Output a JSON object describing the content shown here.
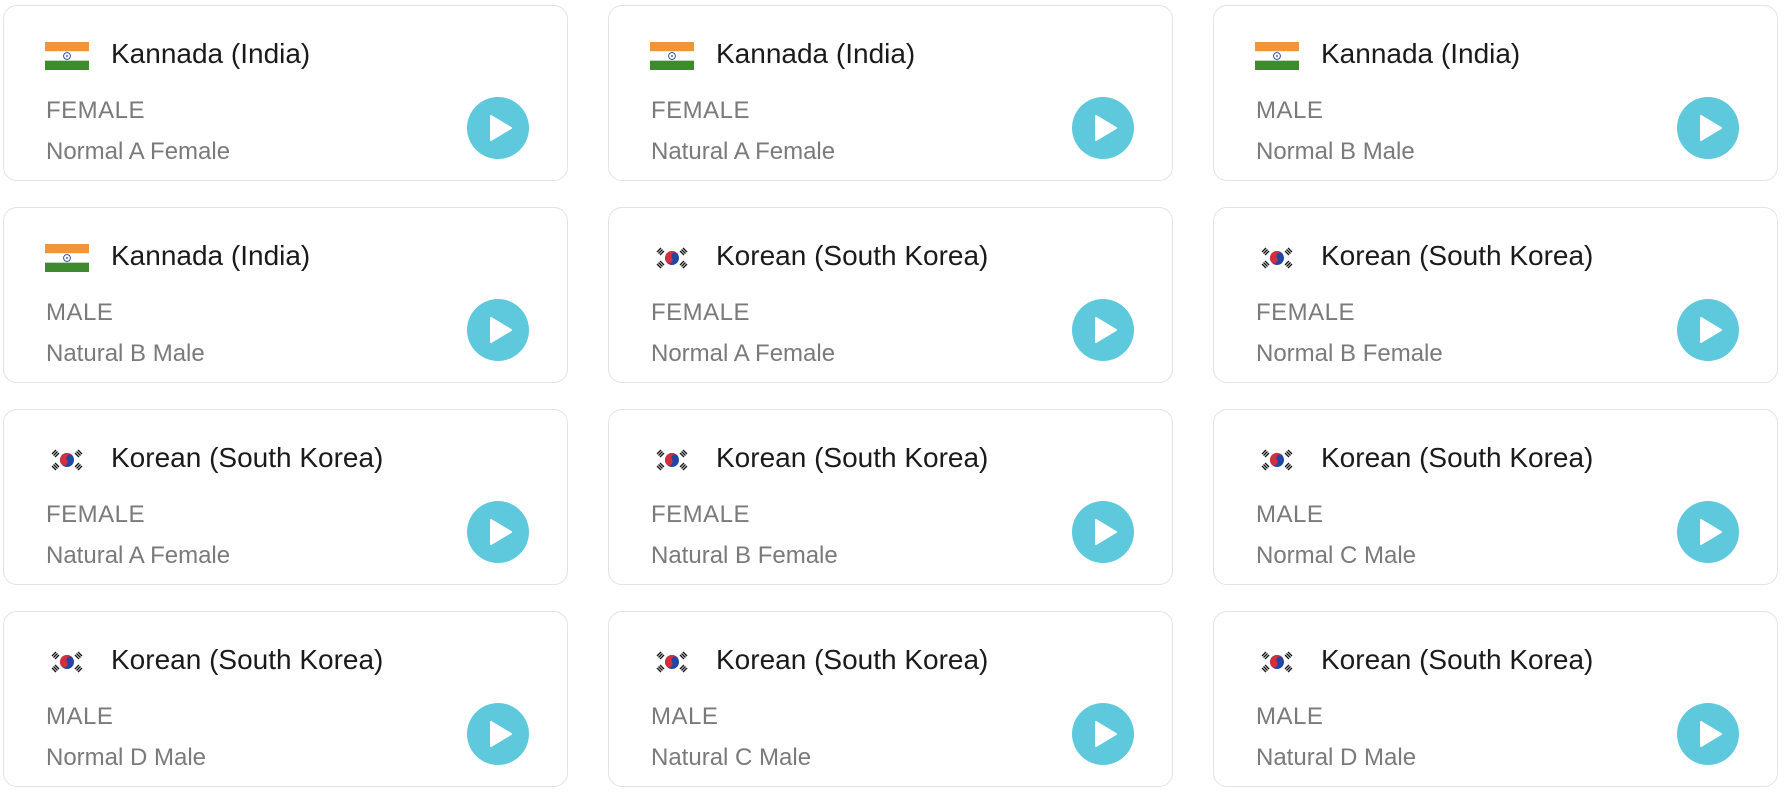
{
  "accent_color": "#5ec8dd",
  "voices": [
    {
      "flag": "india-flag-icon",
      "language": "Kannada (India)",
      "gender": "FEMALE",
      "voice": "Normal A Female"
    },
    {
      "flag": "india-flag-icon",
      "language": "Kannada (India)",
      "gender": "FEMALE",
      "voice": "Natural A Female"
    },
    {
      "flag": "india-flag-icon",
      "language": "Kannada (India)",
      "gender": "MALE",
      "voice": "Normal B Male"
    },
    {
      "flag": "india-flag-icon",
      "language": "Kannada (India)",
      "gender": "MALE",
      "voice": "Natural B Male"
    },
    {
      "flag": "south-korea-flag-icon",
      "language": "Korean (South Korea)",
      "gender": "FEMALE",
      "voice": "Normal A Female"
    },
    {
      "flag": "south-korea-flag-icon",
      "language": "Korean (South Korea)",
      "gender": "FEMALE",
      "voice": "Normal B Female"
    },
    {
      "flag": "south-korea-flag-icon",
      "language": "Korean (South Korea)",
      "gender": "FEMALE",
      "voice": "Natural A Female"
    },
    {
      "flag": "south-korea-flag-icon",
      "language": "Korean (South Korea)",
      "gender": "FEMALE",
      "voice": "Natural B Female"
    },
    {
      "flag": "south-korea-flag-icon",
      "language": "Korean (South Korea)",
      "gender": "MALE",
      "voice": "Normal C Male"
    },
    {
      "flag": "south-korea-flag-icon",
      "language": "Korean (South Korea)",
      "gender": "MALE",
      "voice": "Normal D Male"
    },
    {
      "flag": "south-korea-flag-icon",
      "language": "Korean (South Korea)",
      "gender": "MALE",
      "voice": "Natural C Male"
    },
    {
      "flag": "south-korea-flag-icon",
      "language": "Korean (South Korea)",
      "gender": "MALE",
      "voice": "Natural D Male"
    }
  ]
}
